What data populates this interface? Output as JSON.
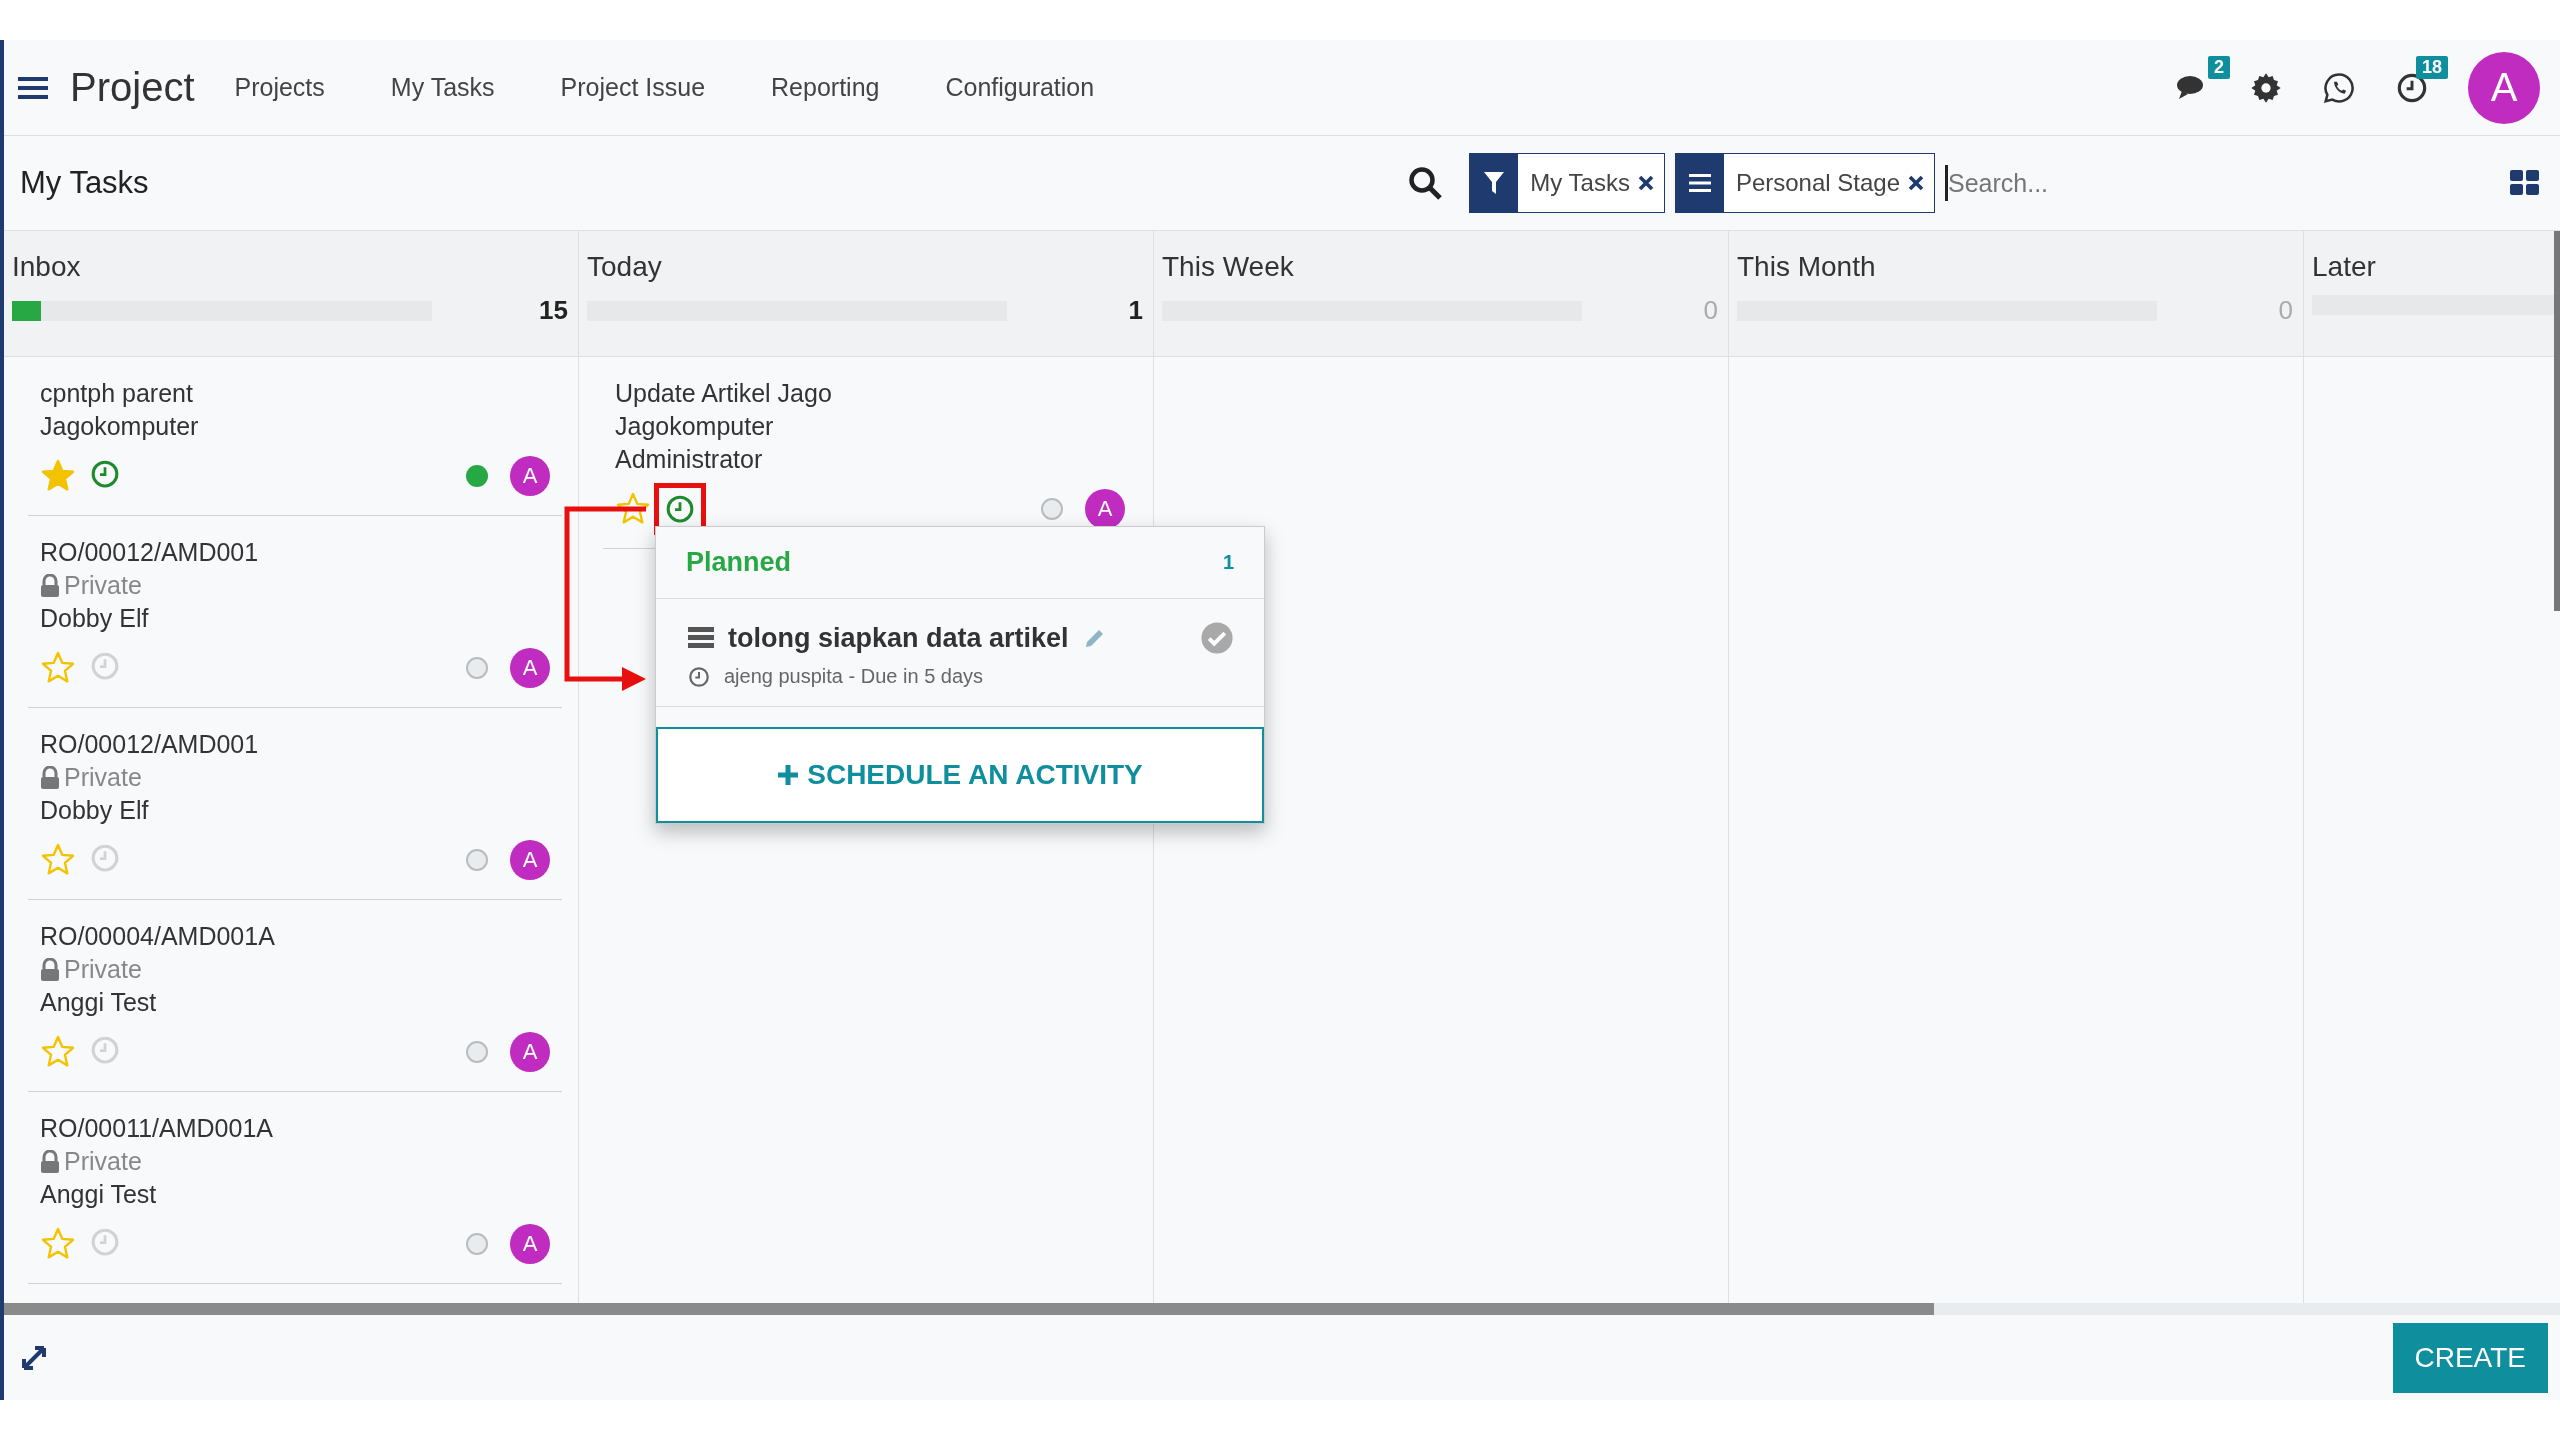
{
  "app": {
    "title": "Project"
  },
  "menu": [
    "Projects",
    "My Tasks",
    "Project Issue",
    "Reporting",
    "Configuration"
  ],
  "systray": {
    "messages_badge": "2",
    "activities_badge": "18",
    "avatar": "A"
  },
  "breadcrumb": "My Tasks",
  "facets": [
    {
      "kind": "filter",
      "label": "My Tasks"
    },
    {
      "kind": "group",
      "label": "Personal Stage"
    }
  ],
  "search": {
    "placeholder": "Search..."
  },
  "columns": [
    {
      "title": "Inbox",
      "count": "15",
      "level": 0.07,
      "cards": [
        {
          "title": "cpntph parent",
          "lines": [
            "Jagokomputer"
          ],
          "starred": true,
          "activity_planned": true,
          "done": true,
          "avatar": "A",
          "highlighted": false
        },
        {
          "title": "RO/00012/AMD001",
          "tag": "Private",
          "lines": [
            "Dobby Elf"
          ],
          "starred": false,
          "activity_planned": false,
          "done": false,
          "avatar": "A",
          "highlighted": false
        },
        {
          "title": "RO/00012/AMD001",
          "tag": "Private",
          "lines": [
            "Dobby Elf"
          ],
          "starred": false,
          "activity_planned": false,
          "done": false,
          "avatar": "A",
          "highlighted": false
        },
        {
          "title": "RO/00004/AMD001A",
          "tag": "Private",
          "lines": [
            "Anggi Test"
          ],
          "starred": false,
          "activity_planned": false,
          "done": false,
          "avatar": "A",
          "highlighted": false
        },
        {
          "title": "RO/00011/AMD001A",
          "tag": "Private",
          "lines": [
            "Anggi Test"
          ],
          "starred": false,
          "activity_planned": false,
          "done": false,
          "avatar": "A",
          "highlighted": false
        }
      ]
    },
    {
      "title": "Today",
      "count": "1",
      "level": 0,
      "cards": [
        {
          "title": "Update Artikel Jago",
          "lines": [
            "Jagokomputer",
            "Administrator"
          ],
          "starred": false,
          "activity_planned": true,
          "done": false,
          "avatar": "A",
          "highlighted": true
        }
      ]
    },
    {
      "title": "This Week",
      "count": "0",
      "level": 0
    },
    {
      "title": "This Month",
      "count": "0",
      "level": 0
    },
    {
      "title": "Later",
      "level": 0
    }
  ],
  "popup": {
    "title": "Planned",
    "count": "1",
    "activities": [
      {
        "summary": "tolong siapkan data artikel",
        "meta": "ajeng puspita - Due in 5 days"
      }
    ],
    "button": "SCHEDULE AN ACTIVITY"
  },
  "create_button": "CREATE"
}
